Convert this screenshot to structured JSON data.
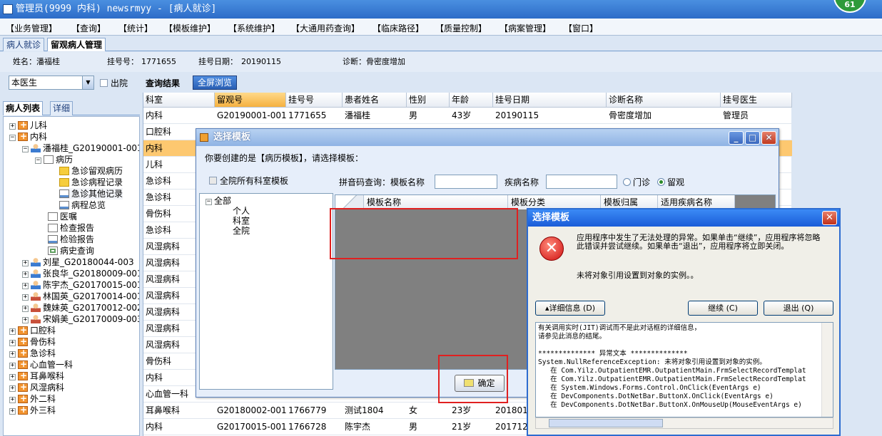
{
  "title": "管理员(9999 内科) newsrmyy - [病人就诊]",
  "badge": "61",
  "menu": [
    "【业务管理】",
    "【查询】",
    "【统计】",
    "【模板维护】",
    "【系统维护】",
    "【大通用药查询】",
    "【临床路径】",
    "【质量控制】",
    "【病案管理】",
    "【窗口】"
  ],
  "main_tabs": [
    "病人就诊",
    "留观病人管理"
  ],
  "info": {
    "name_label": "姓名：潘福桂",
    "reg_no_label": "挂号号：",
    "reg_no": "1771655",
    "reg_date_label": "挂号日期：",
    "reg_date": "20190115",
    "diag_label": "诊断：骨密度增加"
  },
  "left": {
    "doctor_select": "本医生",
    "discharge_label": "出院",
    "tabs": [
      "病人列表",
      "详细"
    ]
  },
  "tree": {
    "n0": "儿科",
    "n1": "内科",
    "n2": "潘福桂_G20190001-001",
    "n3": "病历",
    "n4": "急诊留观病历",
    "n5": "急诊病程记录",
    "n6": "急诊其他记录",
    "n7": "病程总览",
    "n8": "医嘱",
    "n9": "检查报告",
    "n10": "检验报告",
    "n11": "病史查询",
    "n12": "刘星_G20180044-003",
    "n13": "张良华_G20180009-001",
    "n14": "陈宇杰_G20170015-001",
    "n15": "林国英_G20170014-001",
    "n16": "魏妹英_G20170012-002",
    "n17": "宋娟美_G20170009-003",
    "n18": "口腔科",
    "n19": "骨伤科",
    "n20": "急诊科",
    "n21": "心血管一科",
    "n22": "耳鼻喉科",
    "n23": "风湿病科",
    "n24": "外二科",
    "n25": "外三科"
  },
  "query": {
    "title": "查询结果",
    "fullscreen": "全屏浏览"
  },
  "grid": {
    "headers": [
      "科室",
      "留观号",
      "挂号号",
      "患者姓名",
      "性别",
      "年龄",
      "挂号日期",
      "诊断名称",
      "挂号医生"
    ],
    "rows": [
      [
        "内科",
        "G20190001-001",
        "1771655",
        "潘福桂",
        "男",
        "43岁",
        "20190115",
        "骨密度增加",
        "管理员"
      ],
      [
        "口腔科",
        "",
        "",
        "",
        "",
        "",
        "",
        "",
        ""
      ],
      [
        "内科",
        "",
        "",
        "",
        "",
        "",
        "",
        "",
        ""
      ],
      [
        "儿科",
        "",
        "",
        "",
        "",
        "",
        "",
        "",
        ""
      ],
      [
        "急诊科",
        "",
        "",
        "",
        "",
        "",
        "",
        "",
        ""
      ],
      [
        "急诊科",
        "",
        "",
        "",
        "",
        "",
        "",
        "",
        ""
      ],
      [
        "骨伤科",
        "",
        "",
        "",
        "",
        "",
        "",
        "",
        ""
      ],
      [
        "急诊科",
        "",
        "",
        "",
        "",
        "",
        "",
        "",
        ""
      ],
      [
        "风湿病科",
        "",
        "",
        "",
        "",
        "",
        "",
        "",
        ""
      ],
      [
        "风湿病科",
        "",
        "",
        "",
        "",
        "",
        "",
        "",
        ""
      ],
      [
        "风湿病科",
        "",
        "",
        "",
        "",
        "",
        "",
        "",
        ""
      ],
      [
        "风湿病科",
        "",
        "",
        "",
        "",
        "",
        "",
        "",
        ""
      ],
      [
        "风湿病科",
        "",
        "",
        "",
        "",
        "",
        "",
        "",
        ""
      ],
      [
        "风湿病科",
        "",
        "",
        "",
        "",
        "",
        "",
        "",
        ""
      ],
      [
        "风湿病科",
        "",
        "",
        "",
        "",
        "",
        "",
        "",
        ""
      ],
      [
        "骨伤科",
        "",
        "",
        "",
        "",
        "",
        "",
        "",
        ""
      ],
      [
        "内科",
        "",
        "",
        "",
        "",
        "",
        "",
        "",
        ""
      ],
      [
        "心血管一科",
        "",
        "",
        "",
        "",
        "",
        "",
        "",
        ""
      ],
      [
        "耳鼻喉科",
        "G20180002-001",
        "1766779",
        "测试1804",
        "女",
        "23岁",
        "2018010",
        "",
        ""
      ],
      [
        "内科",
        "G20170015-001",
        "1766728",
        "陈宇杰",
        "男",
        "21岁",
        "2017122",
        "",
        ""
      ]
    ]
  },
  "dialog1": {
    "title": "选择模板",
    "prompt": "你要创建的是【病历模板】，请选择模板：",
    "all_dept": "全院所有科室模板",
    "pinyin_label": "拼音码查询：模板名称",
    "disease_label": "疾病名称",
    "radio_outpatient": "门诊",
    "radio_observation": "留观",
    "tree_root": "全部",
    "tree_items": [
      "个人",
      "科室",
      "全院"
    ],
    "headers": [
      "模板名称",
      "模板分类",
      "模板归属",
      "适用疾病名称"
    ],
    "ok": "确定"
  },
  "dialog2": {
    "title": "选择模板",
    "message": "应用程序中发生了无法处理的异常。如果单击“继续”，应用程序将忽略此错误并尝试继续。如果单击“退出”，应用程序将立即关闭。",
    "sub": "未将对象引用设置到对象的实例。。",
    "details_btn": "▴详细信息 (D)",
    "continue_btn": "继续 (C)",
    "quit_btn": "退出 (Q)",
    "details": "有关调用实时(JIT)调试而不是此对话框的详细信息，\n请参见此消息的结尾。\n\n************** 异常文本 **************\nSystem.NullReferenceException: 未将对象引用设置到对象的实例。\n   在 Com.Yilz.OutpatientEMR.OutpatientMain.FrmSelectRecordTemplat\n   在 Com.Yilz.OutpatientEMR.OutpatientMain.FrmSelectRecordTemplat\n   在 System.Windows.Forms.Control.OnClick(EventArgs e)\n   在 DevComponents.DotNetBar.ButtonX.OnClick(EventArgs e)\n   在 DevComponents.DotNetBar.ButtonX.OnMouseUp(MouseEventArgs e)"
  },
  "colors": {
    "highlight_row": "#fdc870",
    "error_border": "#e02020",
    "title_blue": "#2d6cc8"
  }
}
